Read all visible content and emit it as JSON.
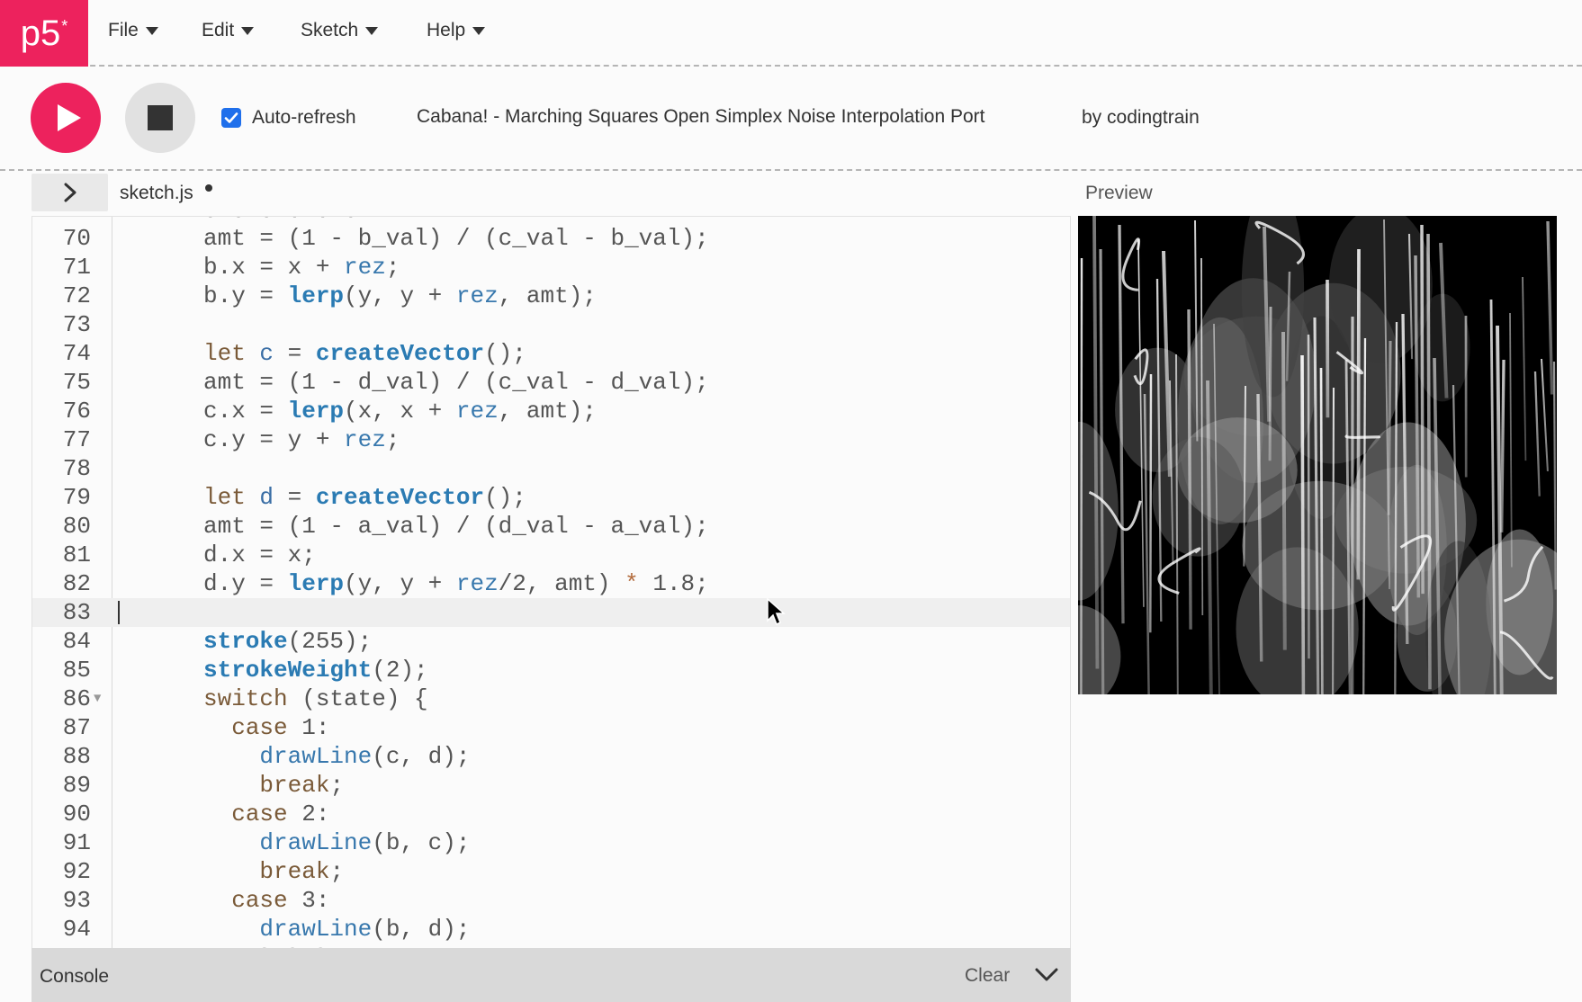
{
  "menubar": {
    "logo": {
      "text": "p5",
      "mark": "*"
    },
    "items": [
      {
        "label": "File"
      },
      {
        "label": "Edit"
      },
      {
        "label": "Sketch"
      },
      {
        "label": "Help"
      }
    ]
  },
  "toolbar": {
    "play_icon": "play-icon",
    "stop_icon": "stop-icon",
    "auto_refresh": {
      "label": "Auto-refresh",
      "checked": true
    },
    "sketch_title": "Cabana! - Marching Squares Open Simplex Noise Interpolation Port",
    "sketch_author": "by codingtrain"
  },
  "tabs": {
    "toggle_icon": "chevron-right-icon",
    "file_name": "sketch.js",
    "unsaved": true,
    "preview_label": "Preview"
  },
  "editor": {
    "active_line": "83",
    "lines": [
      {
        "n": "70",
        "tokens": [
          [
            "t",
            "amt = (1 - b_val) / (c_val - b_val);"
          ]
        ]
      },
      {
        "n": "71",
        "tokens": [
          [
            "t",
            "b.x = x + "
          ],
          [
            "b",
            "rez"
          ],
          [
            "t",
            ";"
          ]
        ]
      },
      {
        "n": "72",
        "tokens": [
          [
            "t",
            "b.y = "
          ],
          [
            "f",
            "lerp"
          ],
          [
            "t",
            "(y, y + "
          ],
          [
            "b",
            "rez"
          ],
          [
            "t",
            ", amt);"
          ]
        ]
      },
      {
        "n": "73",
        "tokens": []
      },
      {
        "n": "74",
        "tokens": [
          [
            "k",
            "let "
          ],
          [
            "v",
            "c"
          ],
          [
            "t",
            " = "
          ],
          [
            "f",
            "createVector"
          ],
          [
            "t",
            "();"
          ]
        ]
      },
      {
        "n": "75",
        "tokens": [
          [
            "t",
            "amt = (1 - d_val) / (c_val - d_val);"
          ]
        ]
      },
      {
        "n": "76",
        "tokens": [
          [
            "t",
            "c.x = "
          ],
          [
            "f",
            "lerp"
          ],
          [
            "t",
            "(x, x + "
          ],
          [
            "b",
            "rez"
          ],
          [
            "t",
            ", amt);"
          ]
        ]
      },
      {
        "n": "77",
        "tokens": [
          [
            "t",
            "c.y = y + "
          ],
          [
            "b",
            "rez"
          ],
          [
            "t",
            ";"
          ]
        ]
      },
      {
        "n": "78",
        "tokens": []
      },
      {
        "n": "79",
        "tokens": [
          [
            "k",
            "let "
          ],
          [
            "v",
            "d"
          ],
          [
            "t",
            " = "
          ],
          [
            "f",
            "createVector"
          ],
          [
            "t",
            "();"
          ]
        ]
      },
      {
        "n": "80",
        "tokens": [
          [
            "t",
            "amt = (1 - a_val) / (d_val - a_val);"
          ]
        ]
      },
      {
        "n": "81",
        "tokens": [
          [
            "t",
            "d.x = x;"
          ]
        ]
      },
      {
        "n": "82",
        "tokens": [
          [
            "t",
            "d.y = "
          ],
          [
            "f",
            "lerp"
          ],
          [
            "t",
            "(y, y + "
          ],
          [
            "b",
            "rez"
          ],
          [
            "t",
            "/2, amt) "
          ],
          [
            "o",
            "*"
          ],
          [
            "t",
            " 1.8;"
          ]
        ]
      },
      {
        "n": "83",
        "tokens": []
      },
      {
        "n": "84",
        "tokens": [
          [
            "f",
            "stroke"
          ],
          [
            "t",
            "(255);"
          ]
        ]
      },
      {
        "n": "85",
        "tokens": [
          [
            "f",
            "strokeWeight"
          ],
          [
            "t",
            "(2);"
          ]
        ]
      },
      {
        "n": "86",
        "fold": true,
        "tokens": [
          [
            "k",
            "switch"
          ],
          [
            "t",
            " (state) {"
          ]
        ]
      },
      {
        "n": "87",
        "tokens": [
          [
            "t",
            "  "
          ],
          [
            "k",
            "case"
          ],
          [
            "t",
            " 1:"
          ]
        ]
      },
      {
        "n": "88",
        "tokens": [
          [
            "t",
            "    "
          ],
          [
            "b",
            "drawLine"
          ],
          [
            "t",
            "(c, d);"
          ]
        ]
      },
      {
        "n": "89",
        "tokens": [
          [
            "t",
            "    "
          ],
          [
            "k",
            "break"
          ],
          [
            "t",
            ";"
          ]
        ]
      },
      {
        "n": "90",
        "tokens": [
          [
            "t",
            "  "
          ],
          [
            "k",
            "case"
          ],
          [
            "t",
            " 2:"
          ]
        ]
      },
      {
        "n": "91",
        "tokens": [
          [
            "t",
            "    "
          ],
          [
            "b",
            "drawLine"
          ],
          [
            "t",
            "(b, c);"
          ]
        ]
      },
      {
        "n": "92",
        "tokens": [
          [
            "t",
            "    "
          ],
          [
            "k",
            "break"
          ],
          [
            "t",
            ";"
          ]
        ]
      },
      {
        "n": "93",
        "tokens": [
          [
            "t",
            "  "
          ],
          [
            "k",
            "case"
          ],
          [
            "t",
            " 3:"
          ]
        ]
      },
      {
        "n": "94",
        "tokens": [
          [
            "t",
            "    "
          ],
          [
            "b",
            "drawLine"
          ],
          [
            "t",
            "(b, d);"
          ]
        ]
      }
    ]
  },
  "console": {
    "title": "Console",
    "clear_label": "Clear",
    "toggle_icon": "chevron-down-icon"
  },
  "colors": {
    "brand": "#ed225d",
    "keyword": "#7a5a38",
    "function": "#2b7bb3",
    "variable": "#3a6ea5",
    "checkbox": "#1f6feb"
  }
}
